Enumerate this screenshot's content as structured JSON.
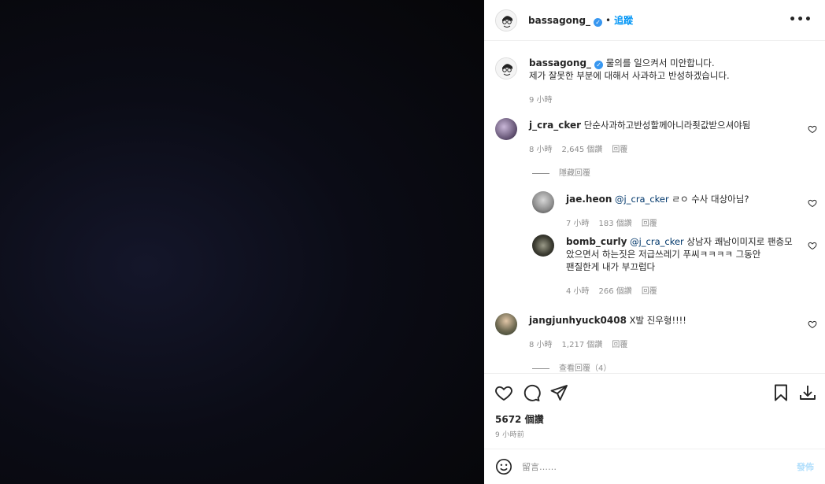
{
  "header": {
    "username": "bassagong_",
    "dot": "•",
    "follow_label": "追蹤",
    "more_label": "•••"
  },
  "caption": {
    "username": "bassagong_",
    "line1": "물의를 일으켜서 미안합니다.",
    "line2": "제가 잘못한 부분에 대해서 사과하고 반성하겠습니다.",
    "time": "9 小時"
  },
  "comments": [
    {
      "username": "j_cra_cker",
      "text": "단순사과하고반성할께아니라죗값받으셔야됨",
      "time": "8 小時",
      "likes": "2,645 個讚",
      "reply_label": "回覆",
      "thread_label": "隱藏回覆",
      "replies": [
        {
          "username": "jae.heon",
          "mention": "@j_cra_cker",
          "text": "ㄹㅇ 수사 대상아님?",
          "time": "7 小時",
          "likes": "183 個讚",
          "reply_label": "回覆"
        },
        {
          "username": "bomb_curly",
          "mention": "@j_cra_cker",
          "text_line1": "상남자 쾌남이미지로 팬층모",
          "text_line2": "았으면서 하는짓은 저급쓰레기 푸씨ㅋㅋㅋㅋ 그동안",
          "text_line3": "팬질한게 내가 부끄럽다",
          "time": "4 小時",
          "likes": "266 個讚",
          "reply_label": "回覆"
        }
      ]
    },
    {
      "username": "jangjunhyuck0408",
      "text": "X발 진우형!!!!",
      "time": "8 小時",
      "likes": "1,217 個讚",
      "reply_label": "回覆",
      "thread_label": "查看回覆（4）"
    }
  ],
  "actions": {
    "likes": "5672 個讚",
    "ago": "9 小時前"
  },
  "comment_box": {
    "placeholder": "留言……",
    "post_label": "發佈"
  },
  "icons": [
    "heart-icon",
    "comment-icon",
    "share-icon",
    "bookmark-icon",
    "download-icon",
    "emoji-icon",
    "verified-icon",
    "more-icon"
  ],
  "colors": {
    "accent": "#0095f6",
    "verified": "#3897f0",
    "muted": "#8e8e8e",
    "text": "#262626"
  }
}
